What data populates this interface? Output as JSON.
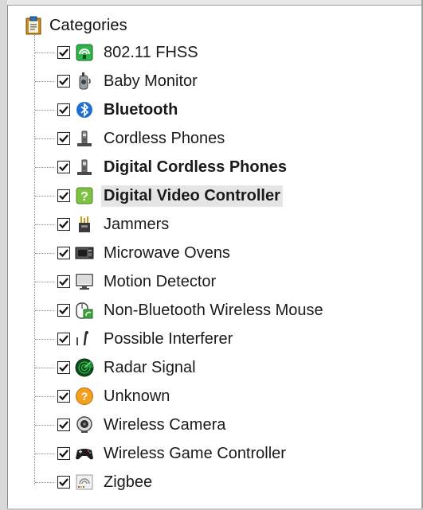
{
  "tree": {
    "root": {
      "label": "Categories",
      "icon": "clipboard-icon"
    },
    "items": [
      {
        "label": "802.11 FHSS",
        "icon": "wifi-router-icon",
        "checked": true,
        "bold": false,
        "selected": false
      },
      {
        "label": "Baby Monitor",
        "icon": "baby-monitor-icon",
        "checked": true,
        "bold": false,
        "selected": false
      },
      {
        "label": "Bluetooth",
        "icon": "bluetooth-icon",
        "checked": true,
        "bold": true,
        "selected": false
      },
      {
        "label": "Cordless Phones",
        "icon": "cordless-phone-icon",
        "checked": true,
        "bold": false,
        "selected": false
      },
      {
        "label": "Digital Cordless Phones",
        "icon": "digital-cordless-phone-icon",
        "checked": true,
        "bold": true,
        "selected": false
      },
      {
        "label": "Digital Video Controller",
        "icon": "question-icon",
        "checked": true,
        "bold": true,
        "selected": true
      },
      {
        "label": "Jammers",
        "icon": "jammer-icon",
        "checked": true,
        "bold": false,
        "selected": false
      },
      {
        "label": "Microwave Ovens",
        "icon": "microwave-icon",
        "checked": true,
        "bold": false,
        "selected": false
      },
      {
        "label": "Motion Detector",
        "icon": "monitor-icon",
        "checked": true,
        "bold": false,
        "selected": false
      },
      {
        "label": "Non-Bluetooth Wireless Mouse",
        "icon": "wireless-mouse-icon",
        "checked": true,
        "bold": false,
        "selected": false
      },
      {
        "label": "Possible Interferer",
        "icon": "interferer-icon",
        "checked": true,
        "bold": false,
        "selected": false
      },
      {
        "label": "Radar Signal",
        "icon": "radar-icon",
        "checked": true,
        "bold": false,
        "selected": false
      },
      {
        "label": "Unknown",
        "icon": "unknown-icon",
        "checked": true,
        "bold": false,
        "selected": false
      },
      {
        "label": "Wireless Camera",
        "icon": "webcam-icon",
        "checked": true,
        "bold": false,
        "selected": false
      },
      {
        "label": "Wireless Game Controller",
        "icon": "gamepad-icon",
        "checked": true,
        "bold": false,
        "selected": false
      },
      {
        "label": "Zigbee",
        "icon": "zigbee-icon",
        "checked": true,
        "bold": false,
        "selected": false
      }
    ]
  },
  "colors": {
    "selection": "#e5e5e5",
    "tree_lines": "#8a8a8a",
    "text": "#1a1a1a"
  }
}
